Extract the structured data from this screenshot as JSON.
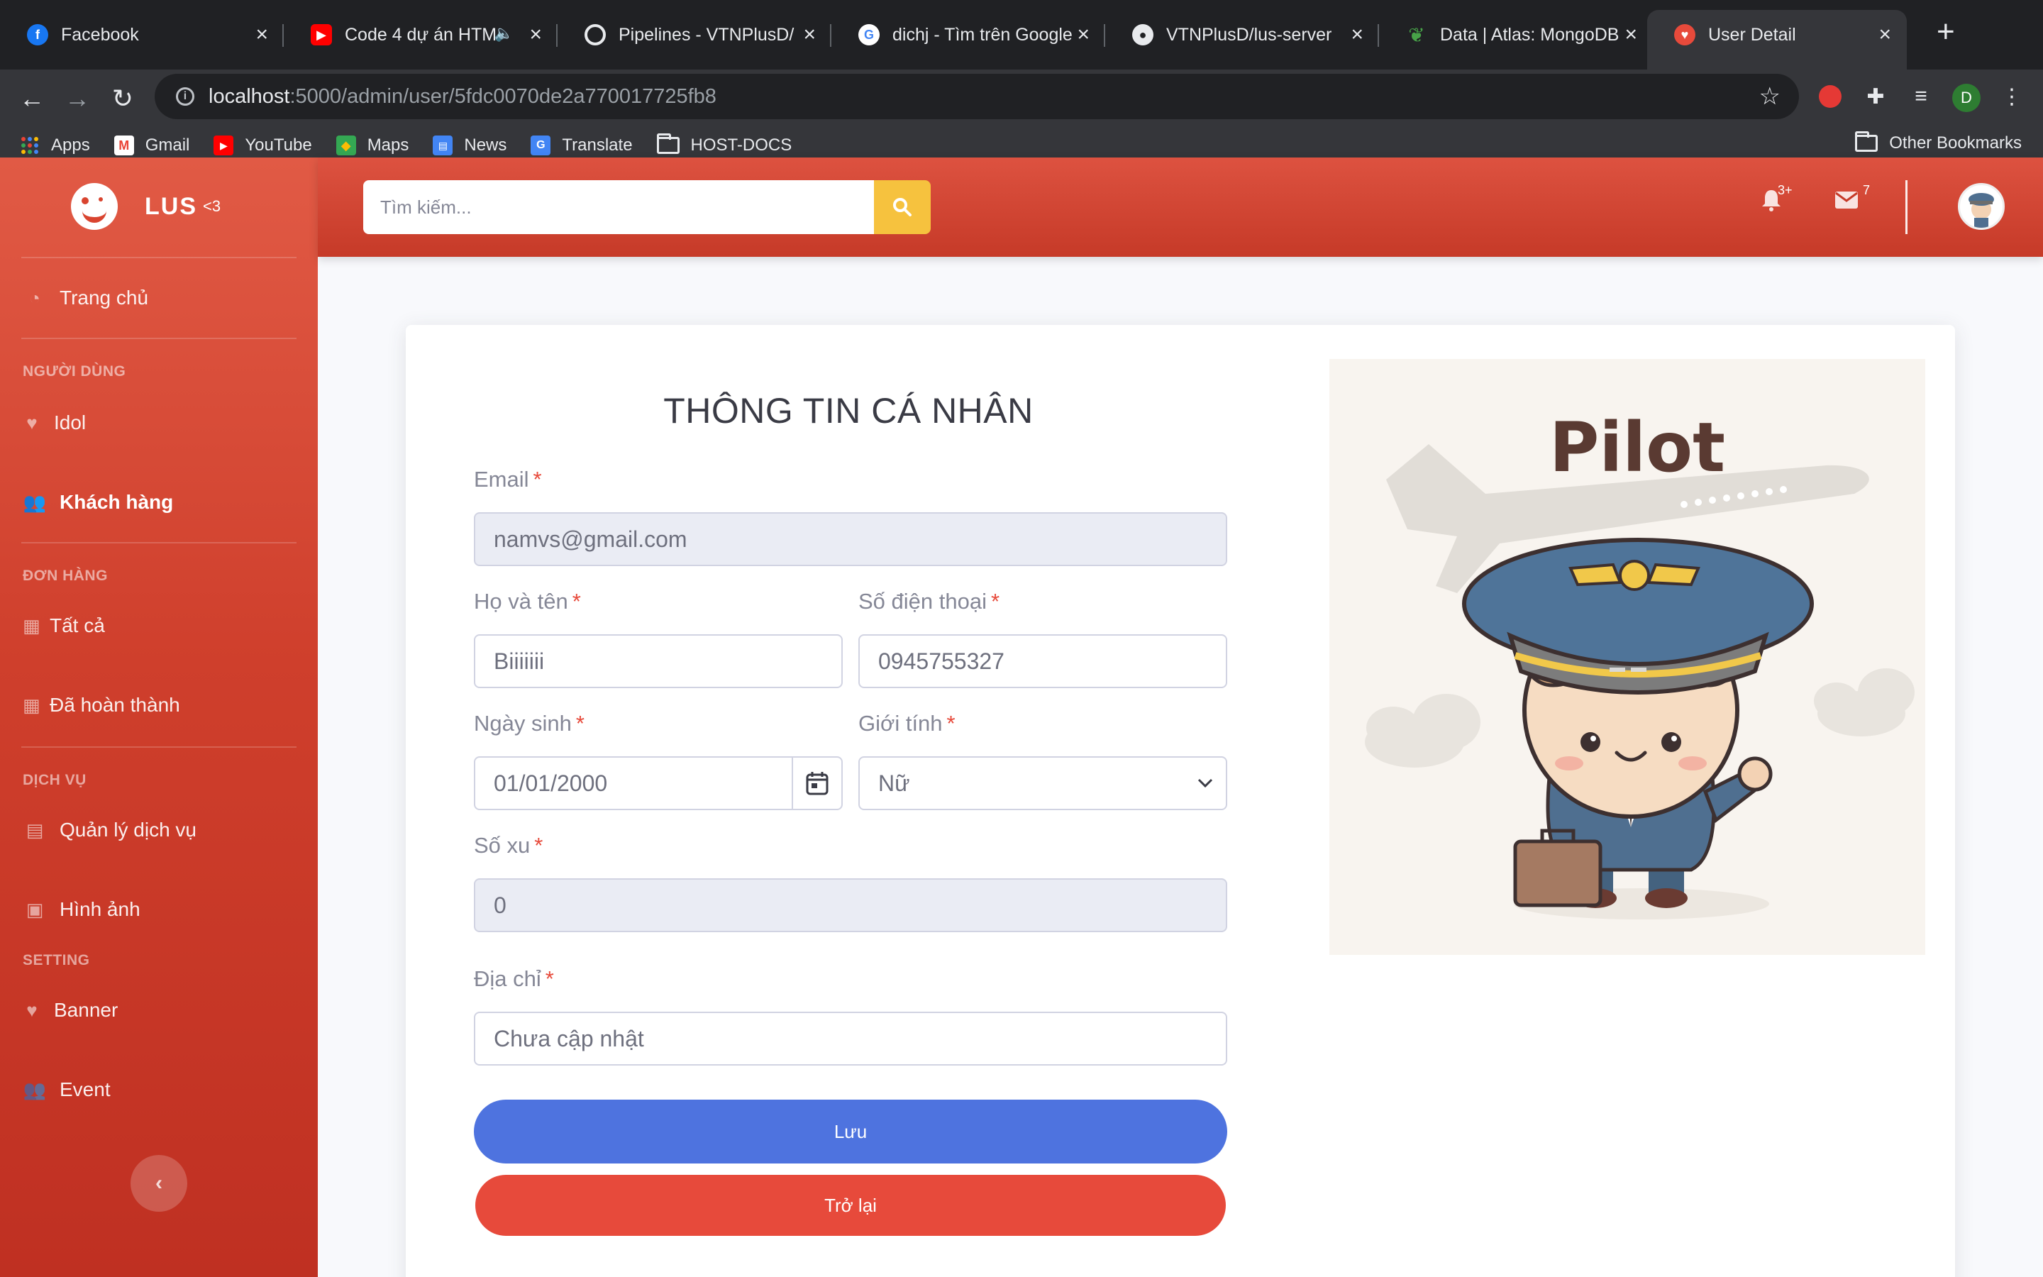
{
  "browser": {
    "tabs": [
      {
        "title": "Facebook",
        "icon": "facebook-icon",
        "color": "#1877f2"
      },
      {
        "title": "Code 4 dự án HTM",
        "icon": "youtube-icon",
        "color": "#ff0000"
      },
      {
        "title": "Pipelines - VTNPlusD/",
        "icon": "pipeline-icon",
        "color": "#e8eaed"
      },
      {
        "title": "dichj - Tìm trên Google",
        "icon": "google-icon",
        "color": "#4285f4"
      },
      {
        "title": "VTNPlusD/lus-server",
        "icon": "github-icon",
        "color": "#e8eaed"
      },
      {
        "title": "Data | Atlas: MongoDB",
        "icon": "mongodb-icon",
        "color": "#47a248"
      },
      {
        "title": "User Detail",
        "icon": "heart-icon",
        "color": "#e74a3b"
      }
    ],
    "url_host": "localhost",
    "url_path": ":5000/admin/user/5fdc0070de2a770017725fb8",
    "profile_initial": "D",
    "bookmarks": [
      {
        "label": "Apps",
        "icon": "apps-grid-icon"
      },
      {
        "label": "Gmail",
        "icon": "gmail-icon"
      },
      {
        "label": "YouTube",
        "icon": "youtube-icon"
      },
      {
        "label": "Maps",
        "icon": "maps-icon"
      },
      {
        "label": "News",
        "icon": "news-icon"
      },
      {
        "label": "Translate",
        "icon": "translate-icon"
      },
      {
        "label": "HOST-DOCS",
        "icon": "folder-icon"
      }
    ],
    "other_bookmarks": "Other Bookmarks"
  },
  "sidebar": {
    "brand": "LUS",
    "brand_sup": "<3",
    "items": [
      {
        "label": "Trang chủ",
        "icon": "dashboard-icon"
      },
      {
        "heading": "NGƯỜI DÙNG"
      },
      {
        "label": "Idol",
        "icon": "heart-pulse-icon"
      },
      {
        "label": "Khách hàng",
        "icon": "users-icon",
        "active": true
      },
      {
        "heading": "ĐƠN HÀNG"
      },
      {
        "label": "Tất cả",
        "icon": "clipboard-icon"
      },
      {
        "label": "Đã hoàn thành",
        "icon": "clipboard-icon"
      },
      {
        "heading": "DỊCH VỤ"
      },
      {
        "label": "Quản lý dịch vụ",
        "icon": "table-icon"
      },
      {
        "label": "Hình ảnh",
        "icon": "images-icon"
      },
      {
        "heading": "SETTING"
      },
      {
        "label": "Banner",
        "icon": "heart-pulse-icon"
      },
      {
        "label": "Event",
        "icon": "users-icon"
      }
    ]
  },
  "topnav": {
    "search_placeholder": "Tìm kiếm...",
    "alerts_badge": "3+",
    "messages_badge": "7"
  },
  "form": {
    "title": "THÔNG TIN CÁ NHÂN",
    "email_label": "Email",
    "email_value": "namvs@gmail.com",
    "name_label": "Họ và tên",
    "name_value": "Biiiiiii",
    "phone_label": "Số điện thoại",
    "phone_value": "0945755327",
    "dob_label": "Ngày sinh",
    "dob_value": "01/01/2000",
    "gender_label": "Giới tính",
    "gender_value": "Nữ",
    "coins_label": "Số xu",
    "coins_value": "0",
    "address_label": "Địa chỉ",
    "address_value": "Chưa cập nhật",
    "required_mark": "*",
    "save_label": "Lưu",
    "back_label": "Trở lại"
  },
  "illustration": {
    "title": "Pilot"
  },
  "colors": {
    "sidebar": "#d9442f",
    "primary": "#4e73df",
    "danger": "#e74a3b",
    "warning": "#f6c23e"
  }
}
